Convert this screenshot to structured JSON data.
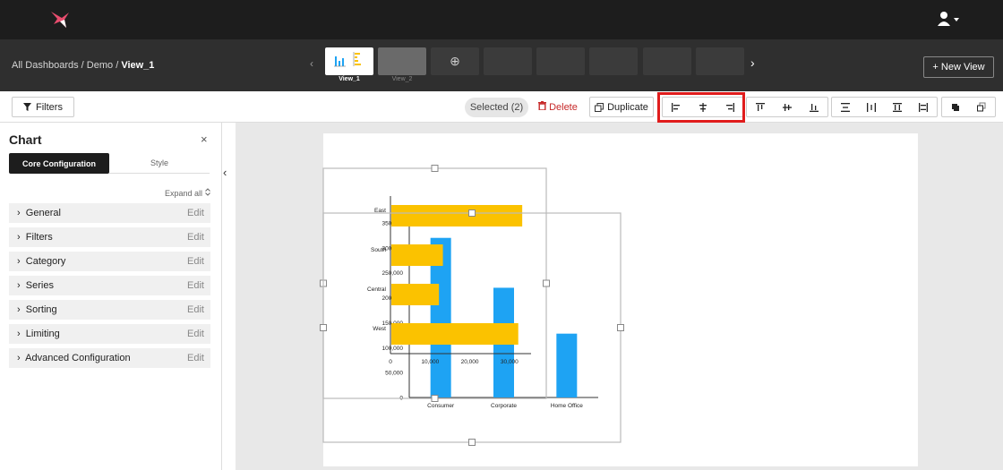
{
  "app": {
    "icons": {
      "logo": "hummingbird-logo",
      "user": "user-icon"
    }
  },
  "breadcrumb": {
    "root": "All Dashboards",
    "separator": "/",
    "folder": "Demo",
    "current": "View_1"
  },
  "views": {
    "items": [
      {
        "label": "View_1",
        "active": true
      },
      {
        "label": "View_2",
        "active": false
      }
    ],
    "add_icon": "⊕",
    "prev_icon": "‹",
    "next_icon": "›",
    "new_view_label": "+ New View"
  },
  "toolbar": {
    "filters_label": "Filters",
    "selected_label": "Selected (2)",
    "delete_label": "Delete",
    "duplicate_label": "Duplicate",
    "align_icons": [
      "align-left-icon",
      "align-center-icon",
      "align-right-icon",
      "align-top-icon",
      "align-middle-icon",
      "align-bottom-icon",
      "distribute-vertical-icon",
      "distribute-horizontal-icon",
      "match-height-icon",
      "match-width-icon",
      "bring-front-icon",
      "send-back-icon"
    ]
  },
  "panel": {
    "title": "Chart",
    "close_icon": "×",
    "tabs": [
      {
        "label": "Core Configuration"
      },
      {
        "label": "Style"
      }
    ],
    "expand_all": "Expand all",
    "sections": [
      {
        "label": "General",
        "edit": "Edit"
      },
      {
        "label": "Filters",
        "edit": "Edit"
      },
      {
        "label": "Category",
        "edit": "Edit"
      },
      {
        "label": "Series",
        "edit": "Edit"
      },
      {
        "label": "Sorting",
        "edit": "Edit"
      },
      {
        "label": "Limiting",
        "edit": "Edit"
      },
      {
        "label": "Advanced Configuration",
        "edit": "Edit"
      }
    ],
    "collapse_icon": "‹"
  },
  "chart_data": [
    {
      "type": "bar",
      "orientation": "vertical",
      "categories": [
        "Consumer",
        "Corporate",
        "Home Office"
      ],
      "values": [
        320000,
        220000,
        128000
      ],
      "ylim": [
        0,
        350000
      ],
      "yticks": [
        "0",
        "50,000",
        "100,000",
        "150,000",
        "200,000",
        "250,000",
        "300,000",
        "350,000"
      ],
      "color": "#1ea3f3"
    },
    {
      "type": "bar",
      "orientation": "horizontal",
      "categories": [
        "East",
        "South",
        "Central",
        "West"
      ],
      "values": [
        33000,
        13000,
        12000,
        32000
      ],
      "xlim": [
        0,
        35000
      ],
      "xticks": [
        "0",
        "10,000",
        "20,000",
        "30,000"
      ],
      "color": "#fbc200"
    }
  ]
}
